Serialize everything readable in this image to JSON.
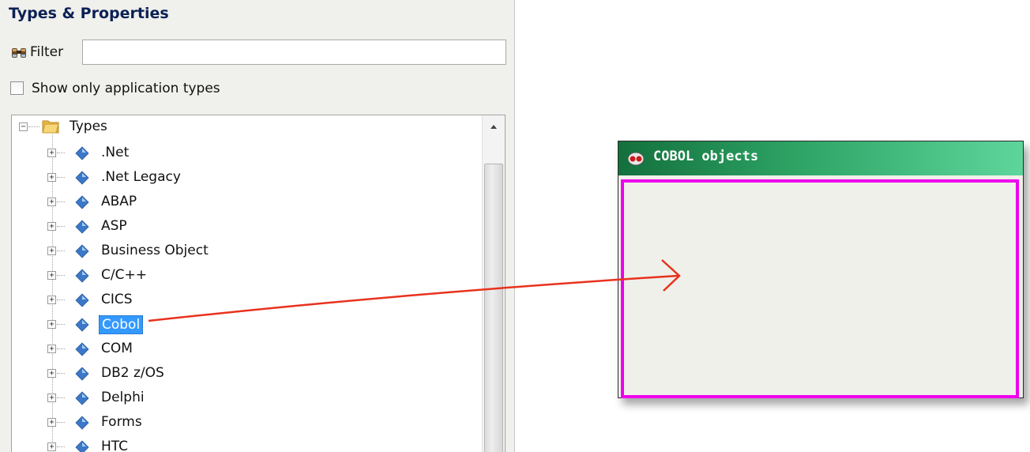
{
  "panel": {
    "title": "Types & Properties",
    "filter": {
      "label": "Filter",
      "icon": "binoculars-icon",
      "value": "",
      "placeholder": ""
    },
    "show_only_app_types": {
      "label": "Show only application types",
      "checked": false
    }
  },
  "tree": {
    "root": {
      "label": "Types",
      "expanded": true,
      "icon": "folder-icon"
    },
    "items": [
      {
        "label": ".Net"
      },
      {
        "label": ".Net Legacy"
      },
      {
        "label": "ABAP"
      },
      {
        "label": "ASP"
      },
      {
        "label": "Business Object"
      },
      {
        "label": "C/C++"
      },
      {
        "label": "CICS"
      },
      {
        "label": "Cobol",
        "selected": true
      },
      {
        "label": "COM"
      },
      {
        "label": "DB2 z/OS"
      },
      {
        "label": "Delphi"
      },
      {
        "label": "Forms"
      },
      {
        "label": "HTC"
      }
    ]
  },
  "cobol_box": {
    "title": "COBOL objects",
    "icon": "object-group-icon",
    "header_color": "#2ea565",
    "border_color": "#ee00ee"
  },
  "annotation": {
    "arrow_color": "#e8321e"
  },
  "colors": {
    "selection": "#3399ff",
    "item_icon": "#3b78c9"
  }
}
